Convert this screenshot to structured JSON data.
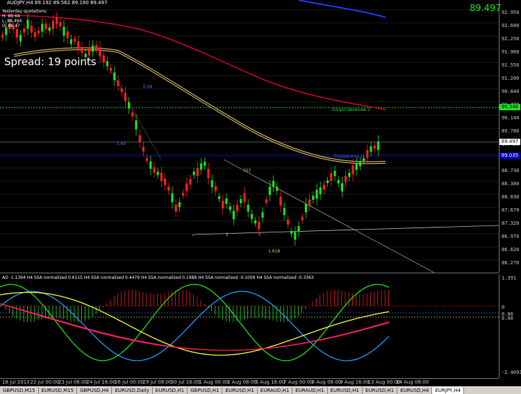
{
  "header": {
    "title": "AUDJPY,H4  89.192 89.562 89.190 89.497"
  },
  "quotes": {
    "title": "Yesterday quotations:",
    "high": "H: 89.64",
    "low": "L: 88.494",
    "open": "O: 88.47"
  },
  "spread": "Spread: 19 points",
  "current_price": "89.497",
  "price_axis": [
    "92.950",
    "92.600",
    "92.250",
    "91.900",
    "91.550",
    "91.200",
    "90.840",
    "90.490",
    "90.140",
    "89.780",
    "89.430",
    "89.080",
    "88.730",
    "88.380",
    "88.030",
    "87.670",
    "87.320",
    "86.970",
    "86.620",
    "86.270"
  ],
  "price_tags": {
    "resistance": "90.348",
    "current": "89.497",
    "support": "89.035"
  },
  "chart_labels": {
    "resistance": "Сопротивление 2",
    "support": "Поддержка 1",
    "fib_0_34": "0.34",
    "fib_1_65": "1.65",
    "fib_1_618": "1.618",
    "n_1": "1",
    "n_2": "1",
    "n_4": "4",
    "n_max": "707"
  },
  "oscillator": {
    "label": "AO -1.1394  H4 SSA normalized 0.6115  H4 SSA normalized 0.4479  H4 SSA normalized 0.1988  H4 SSA normalized -0.1009  H4 SSA normalized -0.3363",
    "axis": [
      "1.391",
      "0",
      "0.00",
      "0.00",
      "-2.40933"
    ]
  },
  "time_axis": [
    "18 Jul 2013",
    "22 Jul 00:00",
    "23 Jul 08:00",
    "24 Jul 16:00",
    "26 Jul 00:00",
    "29 Jul 08:00",
    "30 Jul 16:00",
    "1 Aug 00:00",
    "2 Aug 08:00",
    "5 Aug 16:00",
    "7 Aug 00:00",
    "8 Aug 08:00",
    "9 Aug 16:00",
    "13 Aug 00:00",
    "14 Aug 08:00"
  ],
  "tabs": [
    "GBPUSD,M15",
    "EURUSD,M15",
    "GBPUSD,H4",
    "EURUSD,Daily",
    "EURUSD,H1",
    "GBPUSD,H1",
    "EURUSD,H1",
    "EURAUD,H1",
    "EURAUD,H1",
    "EURUSD,H1",
    "EURUSD,H1",
    "EURUSD,H4",
    "EURJPY,H4"
  ],
  "active_tab": 12,
  "colors": {
    "bull": "#19e619",
    "bear": "#ff2020",
    "ma_red": "#e0002a",
    "ma_blue": "#1e3cff",
    "ma_gold": "#c8b060",
    "support_line": "#0000c8",
    "resistance_line": "#19e619"
  }
}
